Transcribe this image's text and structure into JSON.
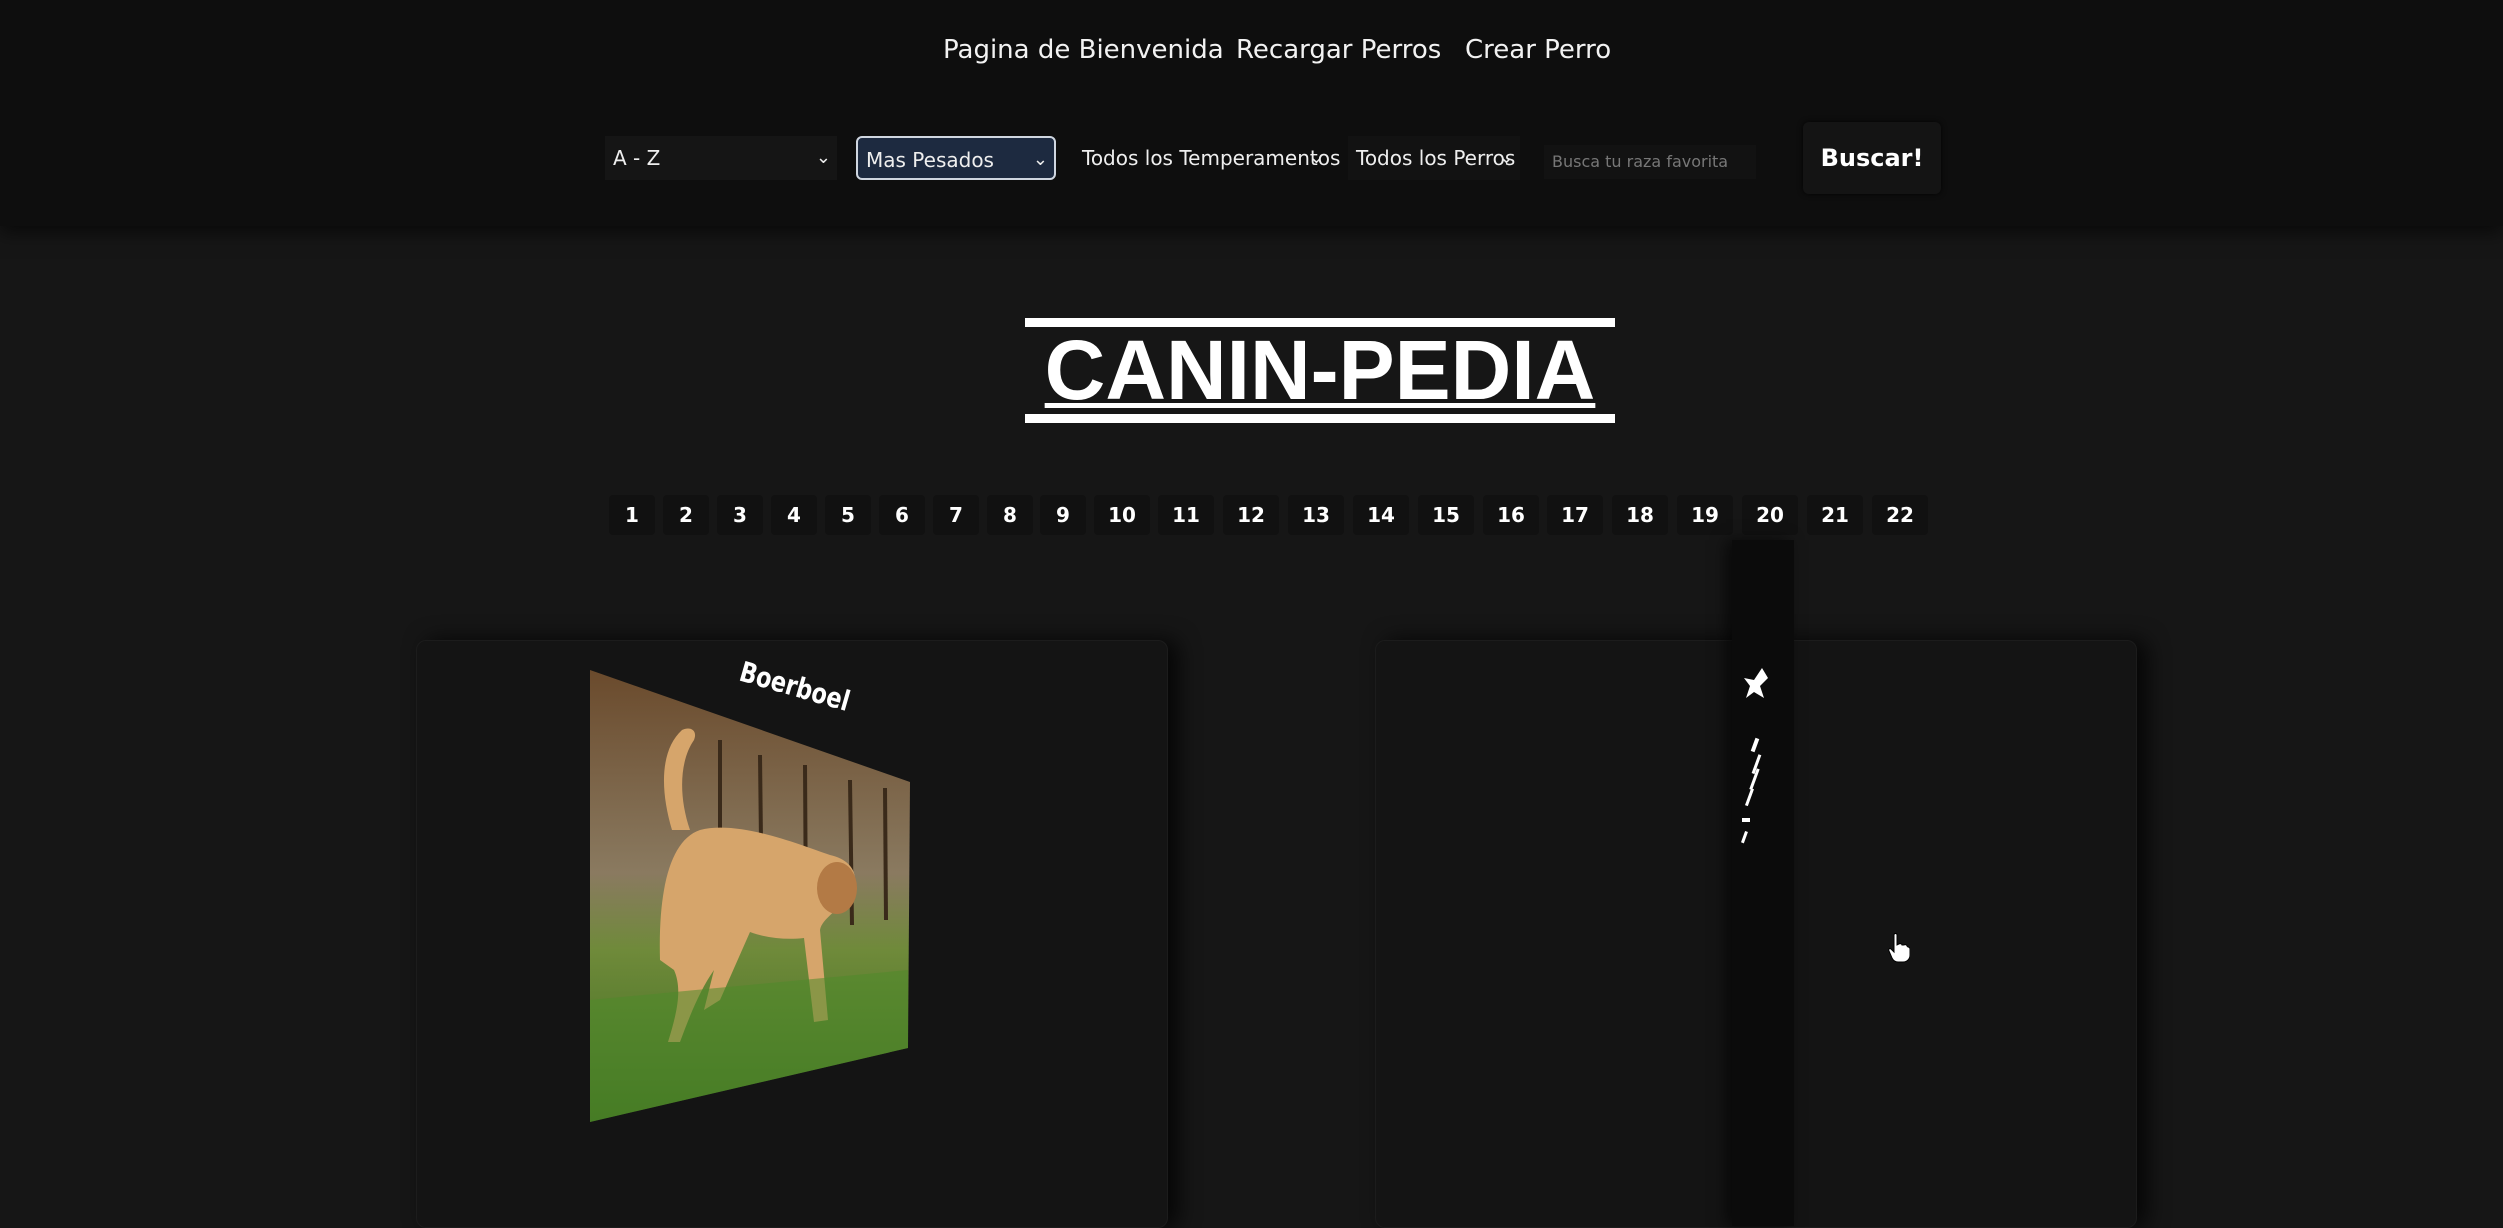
{
  "nav": {
    "welcome": "Pagina de Bienvenida",
    "reload": "Recargar Perros",
    "create": "Crear Perro"
  },
  "filters": {
    "order": "A - Z",
    "weight": "Mas Pesados",
    "temperaments": "Todos los Temperamentos",
    "dogs": "Todos los Perros"
  },
  "search": {
    "placeholder": "Busca tu raza favorita",
    "button": "Buscar!"
  },
  "title": "CANIN-PEDIA",
  "pagination": [
    "1",
    "2",
    "3",
    "4",
    "5",
    "6",
    "7",
    "8",
    "9",
    "10",
    "11",
    "12",
    "13",
    "14",
    "15",
    "16",
    "17",
    "18",
    "19",
    "20",
    "21",
    "22"
  ],
  "cards": [
    {
      "name": "Boerboel",
      "image": "dog-photo"
    }
  ],
  "icons": {
    "chevron": "chevron-down-icon",
    "cursor": "hand-pointer-icon"
  }
}
